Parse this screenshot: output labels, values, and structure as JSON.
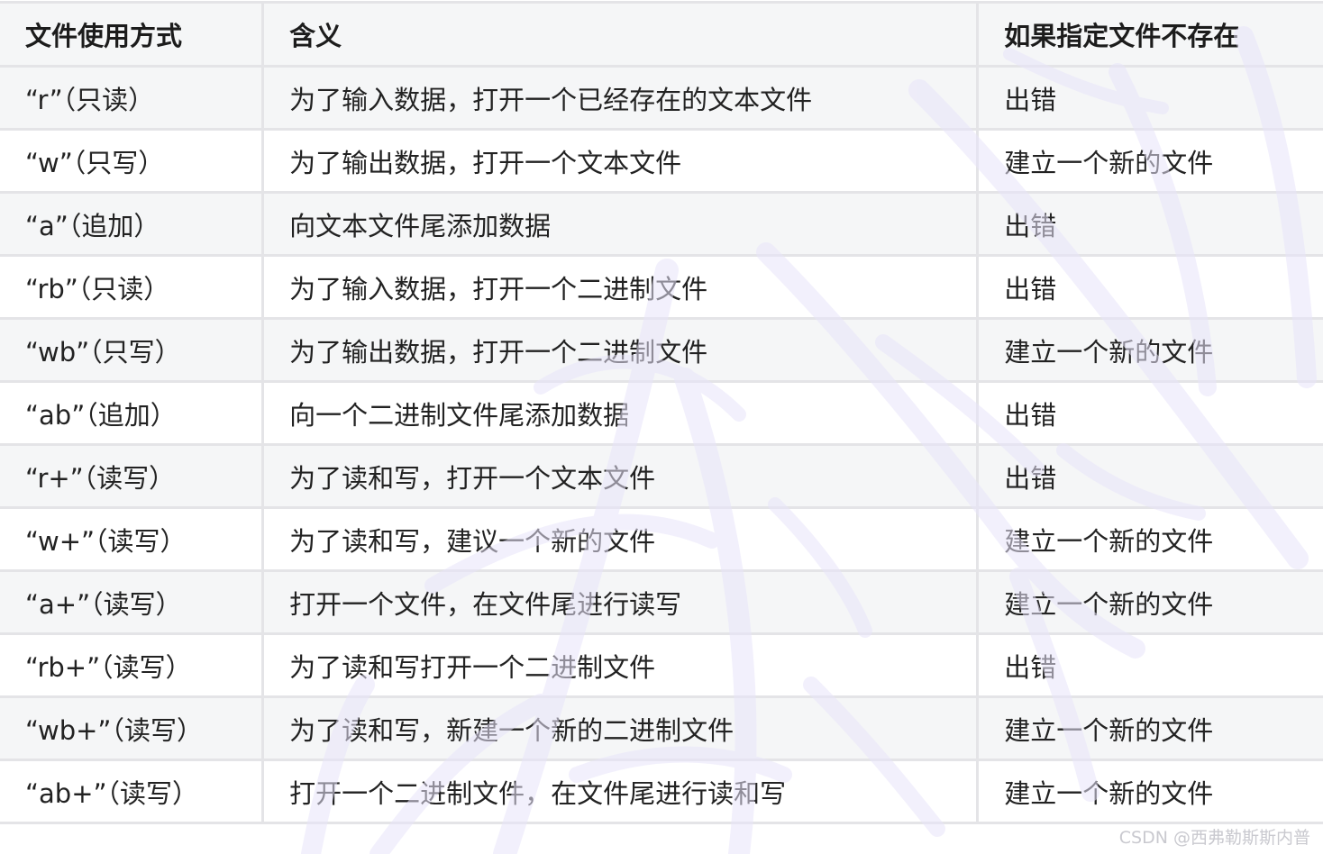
{
  "table": {
    "headers": [
      "文件使用方式",
      "含义",
      "如果指定文件不存在"
    ],
    "rows": [
      [
        "“r”（只读）",
        "为了输入数据，打开一个已经存在的文本文件",
        "出错"
      ],
      [
        "“w”（只写）",
        "为了输出数据，打开一个文本文件",
        "建立一个新的文件"
      ],
      [
        "“a”（追加）",
        "向文本文件尾添加数据",
        "出错"
      ],
      [
        "“rb”（只读）",
        "为了输入数据，打开一个二进制文件",
        "出错"
      ],
      [
        "“wb”（只写）",
        "为了输出数据，打开一个二进制文件",
        "建立一个新的文件"
      ],
      [
        "“ab”（追加）",
        "向一个二进制文件尾添加数据",
        "出错"
      ],
      [
        "“r+”（读写）",
        "为了读和写，打开一个文本文件",
        "出错"
      ],
      [
        "“w+”（读写）",
        "为了读和写，建议一个新的文件",
        "建立一个新的文件"
      ],
      [
        "“a+”（读写）",
        "打开一个文件，在文件尾进行读写",
        "建立一个新的文件"
      ],
      [
        "“rb+”（读写）",
        "为了读和写打开一个二进制文件",
        "出错"
      ],
      [
        "“wb+”（读写）",
        "为了读和写，新建一个新的二进制文件",
        "建立一个新的文件"
      ],
      [
        "“ab+”（读写）",
        "打开一个二进制文件，在文件尾进行读和写",
        "建立一个新的文件"
      ]
    ]
  },
  "watermark": {
    "text": "CSDN @西弗勒斯斯内普",
    "color": "#e8e4fa"
  }
}
